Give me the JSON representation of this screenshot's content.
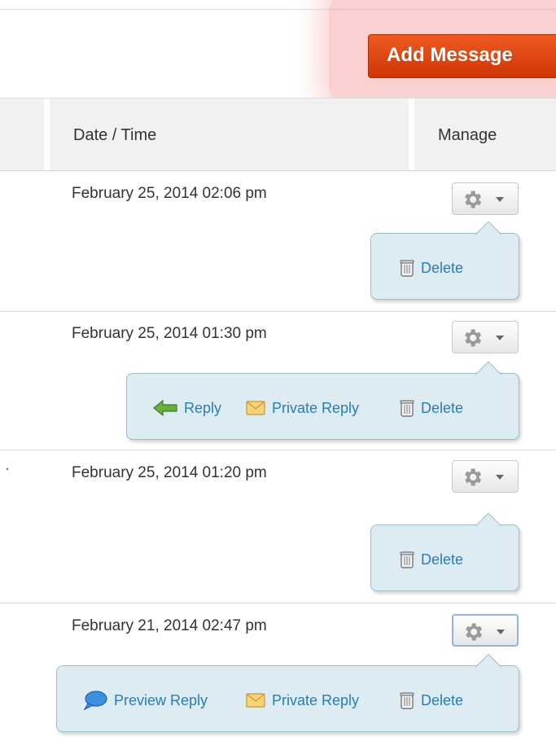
{
  "toolbar": {
    "add_message_label": "Add Message"
  },
  "table": {
    "headers": {
      "datetime": "Date / Time",
      "manage": "Manage"
    },
    "rows": [
      {
        "datetime": "February 25, 2014 02:06 pm",
        "actions": [
          {
            "icon": "trash-icon",
            "label": "Delete"
          }
        ]
      },
      {
        "datetime": "February 25, 2014 01:30 pm",
        "actions": [
          {
            "icon": "reply-arrow-icon",
            "label": "Reply"
          },
          {
            "icon": "envelope-icon",
            "label": "Private Reply"
          },
          {
            "icon": "trash-icon",
            "label": "Delete"
          }
        ]
      },
      {
        "datetime": "February 25, 2014 01:20 pm",
        "actions": [
          {
            "icon": "trash-icon",
            "label": "Delete"
          }
        ]
      },
      {
        "datetime": "February 21, 2014 02:47 pm",
        "actions": [
          {
            "icon": "speech-bubble-icon",
            "label": "Preview Reply"
          },
          {
            "icon": "envelope-icon",
            "label": "Private Reply"
          },
          {
            "icon": "trash-icon",
            "label": "Delete"
          }
        ]
      }
    ]
  },
  "colors": {
    "accent_button": "#e2470f",
    "highlight": "#f06e6e",
    "popover_bg": "#dcecf2",
    "link": "#2a7db0"
  }
}
